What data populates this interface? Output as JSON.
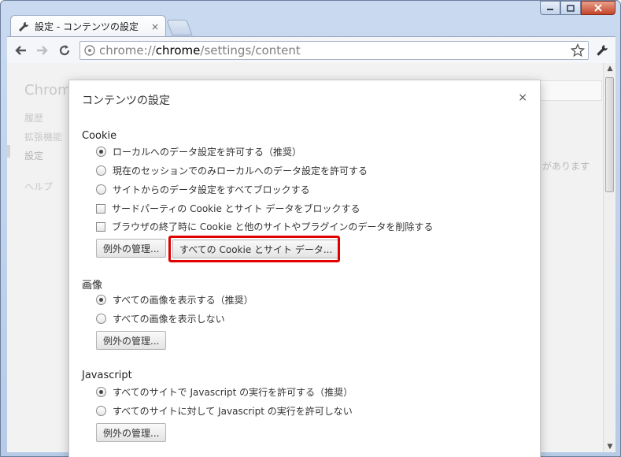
{
  "window": {
    "tab_title": "設定 - コンテンツの設定",
    "tab_close": "×"
  },
  "toolbar": {
    "url_scheme": "chrome://",
    "url_host": "chrome",
    "url_path": "/settings/content"
  },
  "background": {
    "title": "Chrom",
    "nav_items": [
      "履歴",
      "拡張機能",
      "設定"
    ],
    "help": "ヘルプ",
    "text_fragment": "があります"
  },
  "dialog": {
    "title": "コンテンツの設定",
    "close": "×",
    "cookie": {
      "heading": "Cookie",
      "options": [
        "ローカルへのデータ設定を許可する（推奨）",
        "現在のセッションでのみローカルへのデータ設定を許可する",
        "サイトからのデータ設定をすべてブロックする"
      ],
      "checks": [
        "サードパーティの Cookie とサイト データをブロックする",
        "ブラウザの終了時に Cookie と他のサイトやプラグインのデータを削除する"
      ],
      "exceptions_button": "例外の管理...",
      "all_cookies_button": "すべての Cookie とサイト データ..."
    },
    "images": {
      "heading": "画像",
      "options": [
        "すべての画像を表示する（推奨）",
        "すべての画像を表示しない"
      ],
      "exceptions_button": "例外の管理..."
    },
    "javascript": {
      "heading": "Javascript",
      "options": [
        "すべてのサイトで Javascript の実行を許可する（推奨）",
        "すべてのサイトに対して Javascript の実行を許可しない"
      ],
      "exceptions_button": "例外の管理..."
    }
  },
  "colors": {
    "highlight": "#e00000",
    "frame": "#c9daf0"
  }
}
